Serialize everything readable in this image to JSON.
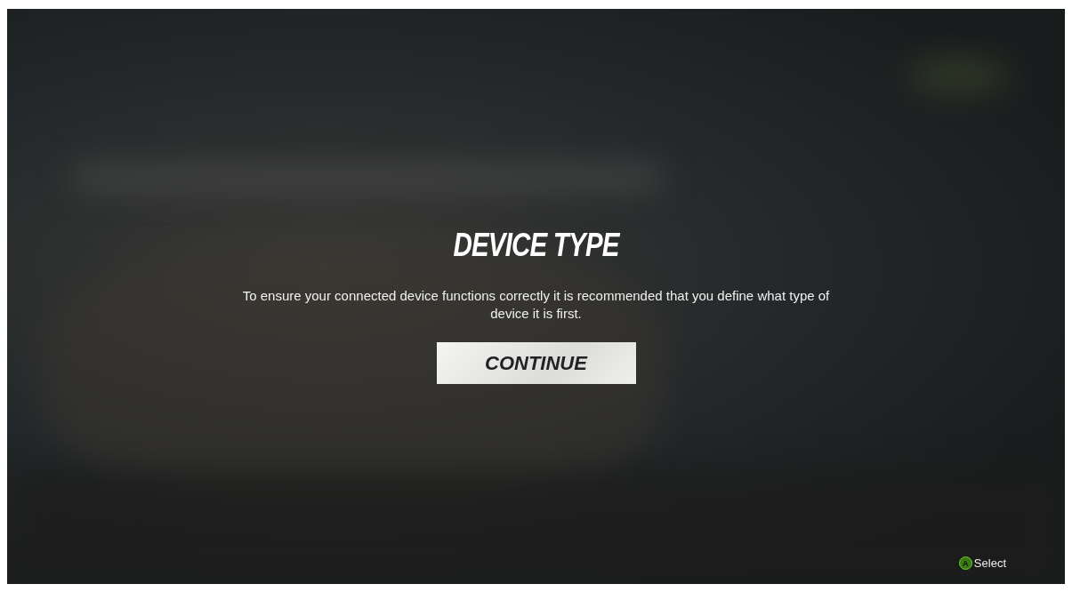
{
  "dialog": {
    "title": "DEVICE TYPE",
    "message": "To ensure your connected device functions correctly it is recommended that you define what type of device it is first.",
    "button": "CONTINUE"
  },
  "hints": [
    {
      "button": "A",
      "label": "Select"
    }
  ]
}
